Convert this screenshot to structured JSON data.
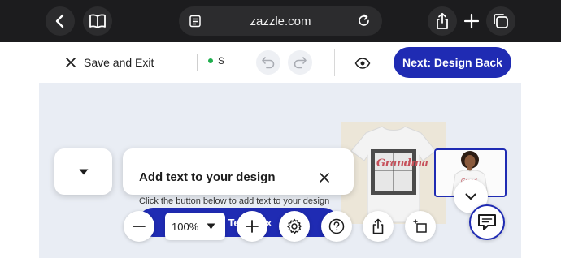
{
  "browser": {
    "url": "zazzle.com",
    "icons": [
      "chevron-left-icon",
      "book-icon",
      "page-settings-icon",
      "reload-icon",
      "share-icon",
      "plus-icon",
      "tabs-icon"
    ]
  },
  "header": {
    "save_exit_label": "Save and Exit",
    "status_text": "S",
    "status_color": "#1fae4d",
    "next_button_label": "Next: Design Back",
    "accent_color": "#1f2bb3"
  },
  "tip": {
    "title": "Add text to your design",
    "subtitle": "Click the button below to add text to your design",
    "button_label": "Add Text Box"
  },
  "toolbar": {
    "zoom_value": "100%"
  },
  "product": {
    "design_text": "Grandma"
  }
}
